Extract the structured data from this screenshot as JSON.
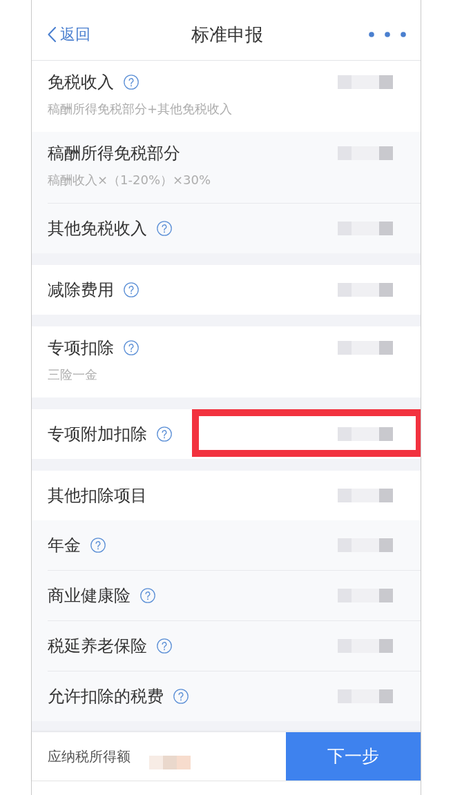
{
  "nav": {
    "back": "返回",
    "title": "标准申报"
  },
  "sections": [
    {
      "items": [
        {
          "kind": "main",
          "label": "免税收入",
          "help": true,
          "note": "稿酬所得免税部分+其他免税收入",
          "redacted": true,
          "highlighted": false
        },
        {
          "kind": "sub",
          "label": "稿酬所得免税部分",
          "help": false,
          "note": "稿酬收入×（1-20%）×30%",
          "redacted": true,
          "highlighted": false
        },
        {
          "kind": "sub",
          "label": "其他免税收入",
          "help": true,
          "redacted": true,
          "highlighted": false
        }
      ]
    },
    {
      "items": [
        {
          "kind": "main",
          "label": "减除费用",
          "help": true,
          "redacted": true,
          "highlighted": false
        }
      ]
    },
    {
      "items": [
        {
          "kind": "main",
          "label": "专项扣除",
          "help": true,
          "note": "三险一金",
          "redacted": true,
          "highlighted": false
        }
      ]
    },
    {
      "items": [
        {
          "kind": "main",
          "label": "专项附加扣除",
          "help": true,
          "redacted": true,
          "highlighted": true
        }
      ]
    },
    {
      "items": [
        {
          "kind": "main",
          "label": "其他扣除项目",
          "help": false,
          "redacted": true,
          "highlighted": false
        },
        {
          "kind": "sub",
          "label": "年金",
          "help": true,
          "redacted": true,
          "highlighted": false
        },
        {
          "kind": "sub",
          "label": "商业健康险",
          "help": true,
          "redacted": true,
          "highlighted": false
        },
        {
          "kind": "sub",
          "label": "税延养老保险",
          "help": true,
          "redacted": true,
          "highlighted": false
        },
        {
          "kind": "sub",
          "label": "允许扣除的税费",
          "help": true,
          "redacted": true,
          "highlighted": false
        }
      ]
    }
  ],
  "footer": {
    "label": "应纳税所得额",
    "redacted": true,
    "button": "下一步"
  }
}
